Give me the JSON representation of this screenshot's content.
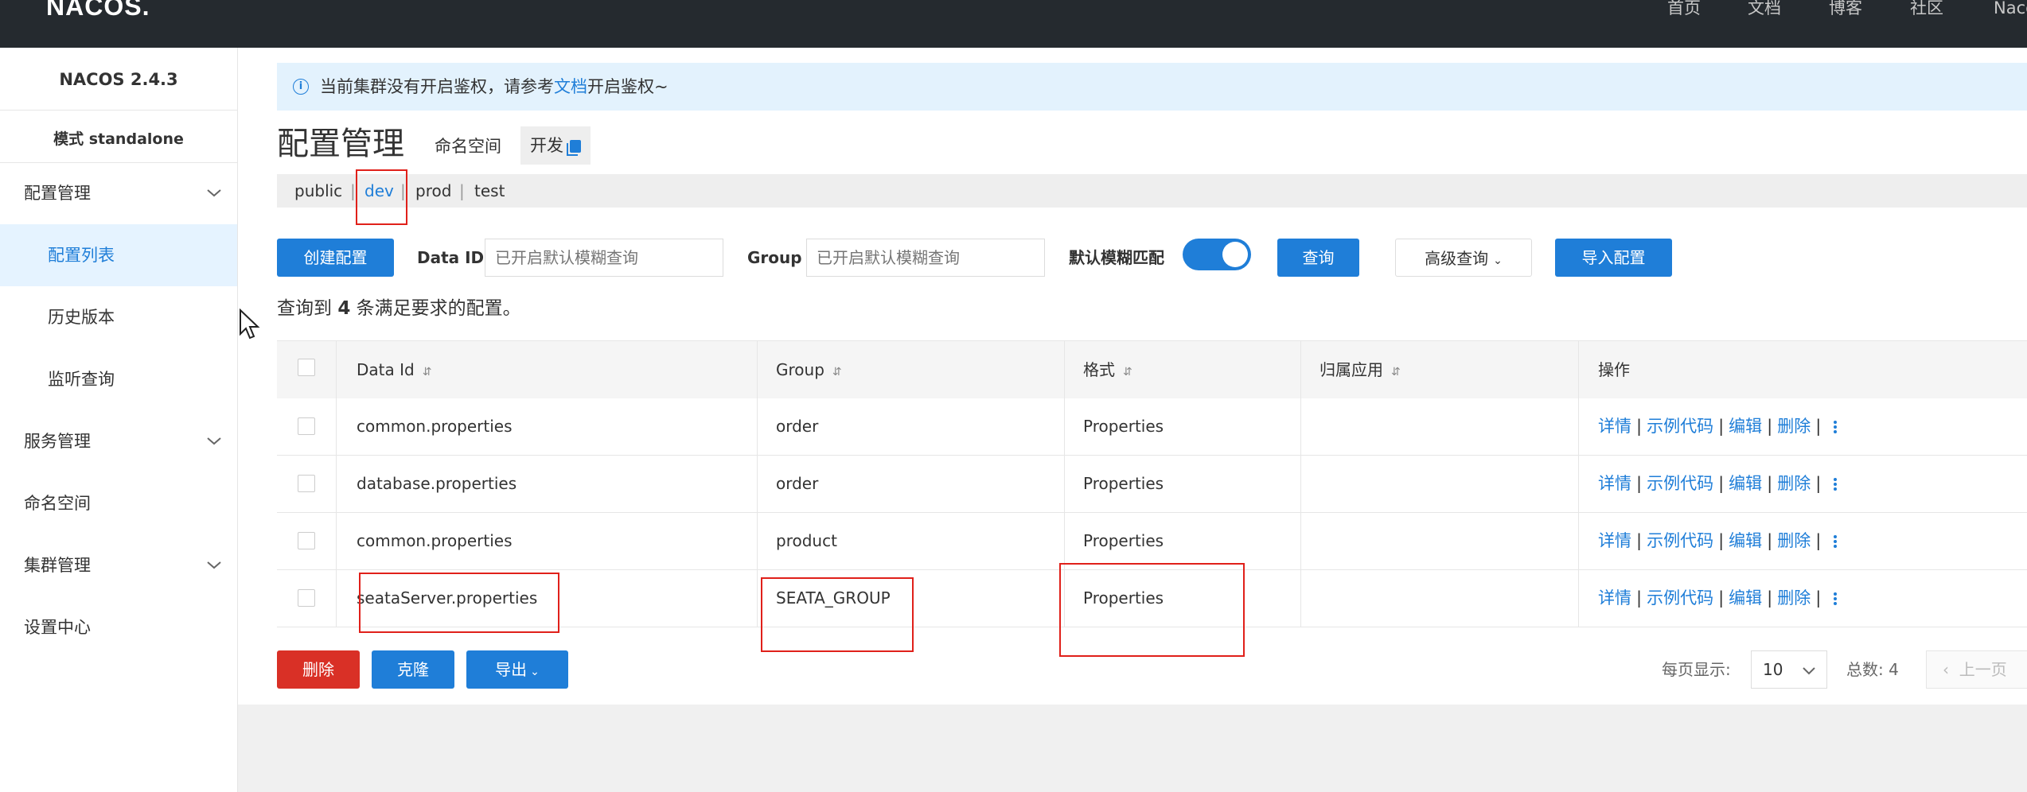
{
  "app": {
    "logo": "NACOS."
  },
  "topnav": {
    "items": [
      "首页",
      "文档",
      "博客",
      "社区",
      "Naco"
    ]
  },
  "sidebar": {
    "version": "NACOS 2.4.3",
    "mode": "模式 standalone",
    "items": [
      {
        "label": "配置管理"
      },
      {
        "label": "配置列表"
      },
      {
        "label": "历史版本"
      },
      {
        "label": "监听查询"
      },
      {
        "label": "服务管理"
      },
      {
        "label": "命名空间"
      },
      {
        "label": "集群管理"
      },
      {
        "label": "设置中心"
      }
    ]
  },
  "notice": {
    "prefix": "当前集群没有开启鉴权，请参考",
    "link": "文档",
    "suffix": "开启鉴权~"
  },
  "page": {
    "title": "配置管理",
    "namespace_label": "命名空间",
    "namespace_value": "开发"
  },
  "namespaces": [
    "public",
    "dev",
    "prod",
    "test"
  ],
  "search": {
    "create_label": "创建配置",
    "dataid_label": "Data ID",
    "dataid_placeholder": "已开启默认模糊查询",
    "group_label": "Group",
    "group_placeholder": "已开启默认模糊查询",
    "fuzzy_label": "默认模糊匹配",
    "query_label": "查询",
    "advanced_label": "高级查询",
    "import_label": "导入配置"
  },
  "result": {
    "prefix": "查询到",
    "count": "4",
    "suffix": "条满足要求的配置。"
  },
  "table": {
    "columns": [
      "Data Id",
      "Group",
      "格式",
      "归属应用",
      "操作"
    ],
    "rows": [
      {
        "data_id": "common.properties",
        "group": "order",
        "format": "Properties",
        "app": ""
      },
      {
        "data_id": "database.properties",
        "group": "order",
        "format": "Properties",
        "app": ""
      },
      {
        "data_id": "common.properties",
        "group": "product",
        "format": "Properties",
        "app": ""
      },
      {
        "data_id": "seataServer.properties",
        "group": "SEATA_GROUP",
        "format": "Properties",
        "app": ""
      }
    ],
    "ops": {
      "detail": "详情",
      "sample": "示例代码",
      "edit": "编辑",
      "delete": "删除"
    }
  },
  "bottom": {
    "delete_label": "删除",
    "clone_label": "克隆",
    "export_label": "导出",
    "page_size_label": "每页显示:",
    "page_size": "10",
    "total_label": "总数:",
    "total": "4",
    "prev_label": "上一页"
  }
}
